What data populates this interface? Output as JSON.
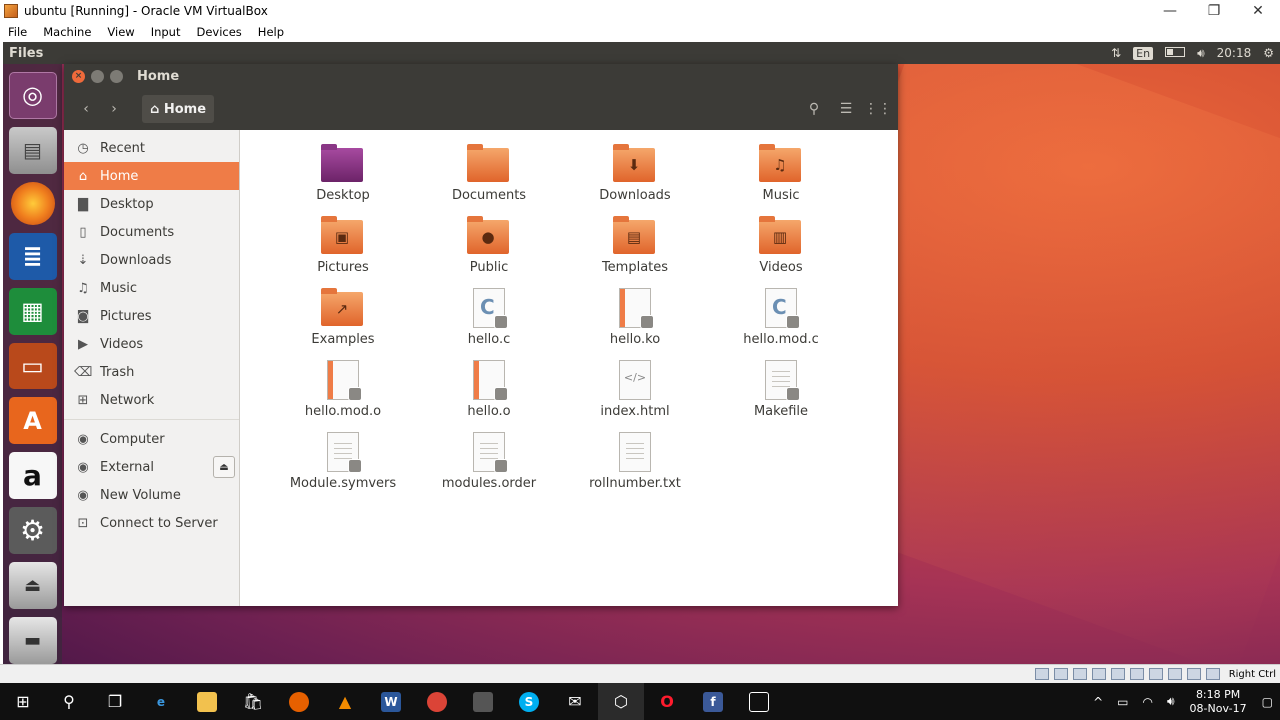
{
  "host": {
    "title": "ubuntu [Running] - Oracle VM VirtualBox",
    "menu": [
      "File",
      "Machine",
      "View",
      "Input",
      "Devices",
      "Help"
    ],
    "controls": {
      "minimize": "—",
      "restore": "❐",
      "close": "✕"
    }
  },
  "ubuntu_topbar": {
    "app_name": "Files",
    "lang": "En",
    "time": "20:18"
  },
  "window": {
    "title": "Home",
    "crumb": "Home"
  },
  "sidebar": {
    "places": [
      {
        "label": "Recent",
        "icon": "clock-icon"
      },
      {
        "label": "Home",
        "icon": "home-icon",
        "active": true
      },
      {
        "label": "Desktop",
        "icon": "folder-icon"
      },
      {
        "label": "Documents",
        "icon": "document-icon"
      },
      {
        "label": "Downloads",
        "icon": "download-icon"
      },
      {
        "label": "Music",
        "icon": "music-icon"
      },
      {
        "label": "Pictures",
        "icon": "camera-icon"
      },
      {
        "label": "Videos",
        "icon": "video-icon"
      },
      {
        "label": "Trash",
        "icon": "trash-icon"
      },
      {
        "label": "Network",
        "icon": "network-icon"
      }
    ],
    "devices": [
      {
        "label": "Computer",
        "icon": "drive-icon"
      },
      {
        "label": "External",
        "icon": "drive-icon"
      },
      {
        "label": "New Volume",
        "icon": "drive-icon"
      },
      {
        "label": "Connect to Server",
        "icon": "server-icon"
      }
    ]
  },
  "files": [
    {
      "name": "Desktop",
      "kind": "folder",
      "emblem": "desktop"
    },
    {
      "name": "Documents",
      "kind": "folder",
      "emblem": ""
    },
    {
      "name": "Downloads",
      "kind": "folder",
      "emblem": "download"
    },
    {
      "name": "Music",
      "kind": "folder",
      "emblem": "music"
    },
    {
      "name": "Pictures",
      "kind": "folder",
      "emblem": "pictures"
    },
    {
      "name": "Public",
      "kind": "folder",
      "emblem": "person"
    },
    {
      "name": "Templates",
      "kind": "folder",
      "emblem": "template"
    },
    {
      "name": "Videos",
      "kind": "folder",
      "emblem": "video"
    },
    {
      "name": "Examples",
      "kind": "folder",
      "emblem": "link"
    },
    {
      "name": "hello.c",
      "kind": "c-source"
    },
    {
      "name": "hello.ko",
      "kind": "binary"
    },
    {
      "name": "hello.mod.c",
      "kind": "c-source"
    },
    {
      "name": "hello.mod.o",
      "kind": "binary"
    },
    {
      "name": "hello.o",
      "kind": "binary"
    },
    {
      "name": "index.html",
      "kind": "html"
    },
    {
      "name": "Makefile",
      "kind": "text-locked"
    },
    {
      "name": "Module.symvers",
      "kind": "text-locked"
    },
    {
      "name": "modules.order",
      "kind": "text-locked"
    },
    {
      "name": "rollnumber.txt",
      "kind": "text"
    }
  ],
  "statusbar": {
    "host_key": "Right Ctrl"
  },
  "taskbar": {
    "time": "8:18 PM",
    "date": "08-Nov-17"
  }
}
